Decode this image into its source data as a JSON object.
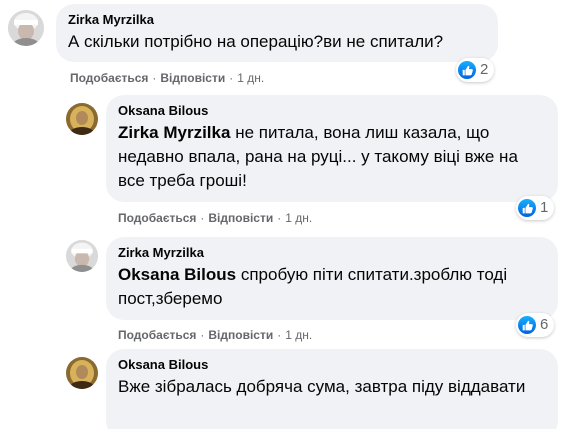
{
  "comments": [
    {
      "author": "Zirka Myrzilka",
      "mention": "",
      "text": "А скільки потрібно на операцію?ви не спитали?",
      "like_label": "Подобається",
      "reply_label": "Відповісти",
      "time": "1 дн.",
      "reactions": "2"
    },
    {
      "author": "Oksana Bilous",
      "mention": "Zirka Myrzilka",
      "text": "не питала, вона лиш казала, що недавно впала, рана на руці... у такому віці вже на все треба гроші!",
      "like_label": "Подобається",
      "reply_label": "Відповісти",
      "time": "1 дн.",
      "reactions": "1"
    },
    {
      "author": "Zirka Myrzilka",
      "mention": "Oksana Bilous",
      "text": "спробую піти спитати.зроблю тоді пост,зберемо",
      "like_label": "Подобається",
      "reply_label": "Відповісти",
      "time": "1 дн.",
      "reactions": "6"
    },
    {
      "author": "Oksana Bilous",
      "mention": "",
      "text": "Вже зібралась добряча сума, завтра піду віддавати"
    }
  ],
  "separator": "·",
  "icons": {
    "reaction": "like-icon"
  },
  "colors": {
    "like_blue": "#1877f2",
    "bubble": "#f0f2f5",
    "meta_text": "#65676b"
  }
}
